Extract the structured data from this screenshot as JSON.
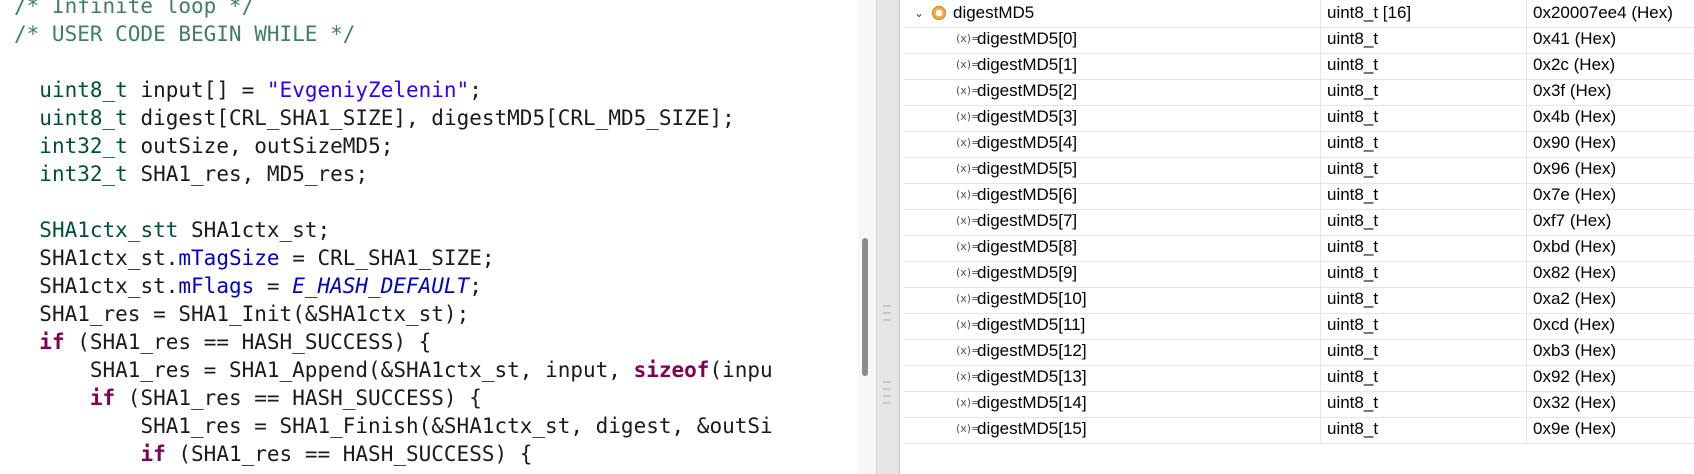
{
  "editor": {
    "lines": [
      "/* Infinite loop */",
      "/* USER CODE BEGIN WHILE */",
      "",
      "  uint8_t input[] = \"EvgeniyZelenin\";",
      "  uint8_t digest[CRL_SHA1_SIZE], digestMD5[CRL_MD5_SIZE];",
      "  int32_t outSize, outSizeMD5;",
      "  int32_t SHA1_res, MD5_res;",
      "",
      "  SHA1ctx_stt SHA1ctx_st;",
      "  SHA1ctx_st.mTagSize = CRL_SHA1_SIZE;",
      "  SHA1ctx_st.mFlags = E_HASH_DEFAULT;",
      "  SHA1_res = SHA1_Init(&SHA1ctx_st);",
      "  if (SHA1_res == HASH_SUCCESS) {",
      "      SHA1_res = SHA1_Append(&SHA1ctx_st, input, sizeof(inpu",
      "      if (SHA1_res == HASH_SUCCESS) {",
      "          SHA1_res = SHA1_Finish(&SHA1ctx_st, digest, &outSi",
      "          if (SHA1_res == HASH_SUCCESS) {"
    ]
  },
  "variables": {
    "parent": {
      "name": "digestMD5",
      "type": "uint8_t [16]",
      "value": "0x20007ee4 (Hex)",
      "expand_icon": "chevron-down-icon",
      "icon": "struct-object-icon"
    },
    "children": [
      {
        "name": "digestMD5[0]",
        "type": "uint8_t",
        "value": "0x41 (Hex)"
      },
      {
        "name": "digestMD5[1]",
        "type": "uint8_t",
        "value": "0x2c (Hex)"
      },
      {
        "name": "digestMD5[2]",
        "type": "uint8_t",
        "value": "0x3f (Hex)"
      },
      {
        "name": "digestMD5[3]",
        "type": "uint8_t",
        "value": "0x4b (Hex)"
      },
      {
        "name": "digestMD5[4]",
        "type": "uint8_t",
        "value": "0x90 (Hex)"
      },
      {
        "name": "digestMD5[5]",
        "type": "uint8_t",
        "value": "0x96 (Hex)"
      },
      {
        "name": "digestMD5[6]",
        "type": "uint8_t",
        "value": "0x7e (Hex)"
      },
      {
        "name": "digestMD5[7]",
        "type": "uint8_t",
        "value": "0xf7 (Hex)"
      },
      {
        "name": "digestMD5[8]",
        "type": "uint8_t",
        "value": "0xbd (Hex)"
      },
      {
        "name": "digestMD5[9]",
        "type": "uint8_t",
        "value": "0x82 (Hex)"
      },
      {
        "name": "digestMD5[10]",
        "type": "uint8_t",
        "value": "0xa2 (Hex)"
      },
      {
        "name": "digestMD5[11]",
        "type": "uint8_t",
        "value": "0xcd (Hex)"
      },
      {
        "name": "digestMD5[12]",
        "type": "uint8_t",
        "value": "0xb3 (Hex)"
      },
      {
        "name": "digestMD5[13]",
        "type": "uint8_t",
        "value": "0x92 (Hex)"
      },
      {
        "name": "digestMD5[14]",
        "type": "uint8_t",
        "value": "0x32 (Hex)"
      },
      {
        "name": "digestMD5[15]",
        "type": "uint8_t",
        "value": "0x9e (Hex)"
      }
    ],
    "child_icon": "variable-icon"
  },
  "colors": {
    "comment": "#3f7f5f",
    "type": "#005032",
    "string": "#2a00ff",
    "keyword": "#7f0055",
    "field": "#0000c0"
  }
}
